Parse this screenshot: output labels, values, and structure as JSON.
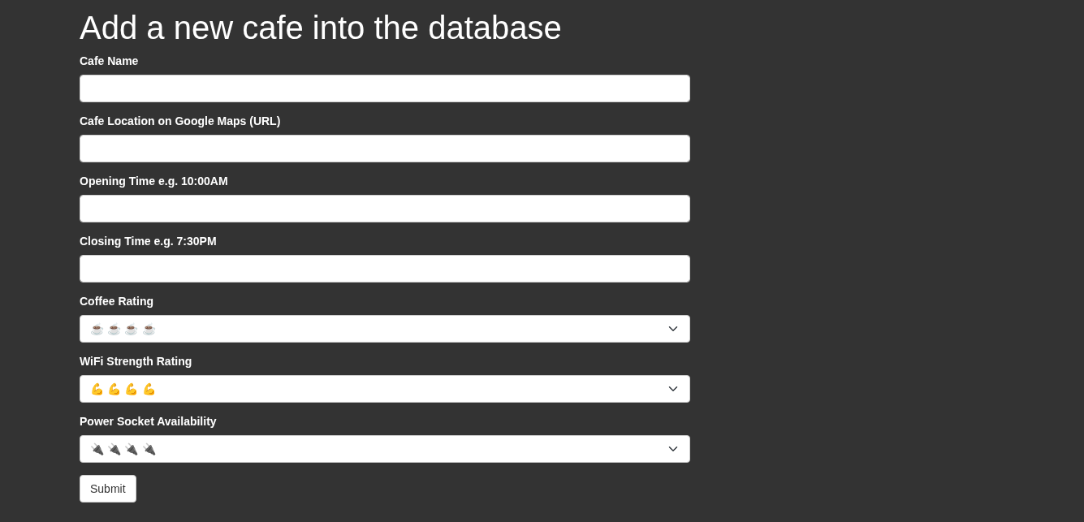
{
  "title": "Add a new cafe into the database",
  "fields": [
    {
      "kind": "text",
      "label": "Cafe Name"
    },
    {
      "kind": "text",
      "label": "Cafe Location on Google Maps (URL)"
    },
    {
      "kind": "text",
      "label": "Opening Time e.g. 10:00AM"
    },
    {
      "kind": "text",
      "label": "Closing Time e.g. 7:30PM"
    },
    {
      "kind": "select",
      "label": "Coffee Rating",
      "value": "☕️☕️☕️☕️"
    },
    {
      "kind": "select",
      "label": "WiFi Strength Rating",
      "value": "💪💪💪💪"
    },
    {
      "kind": "select",
      "label": "Power Socket Availability",
      "value": "🔌🔌🔌🔌"
    }
  ],
  "submit": "Submit"
}
